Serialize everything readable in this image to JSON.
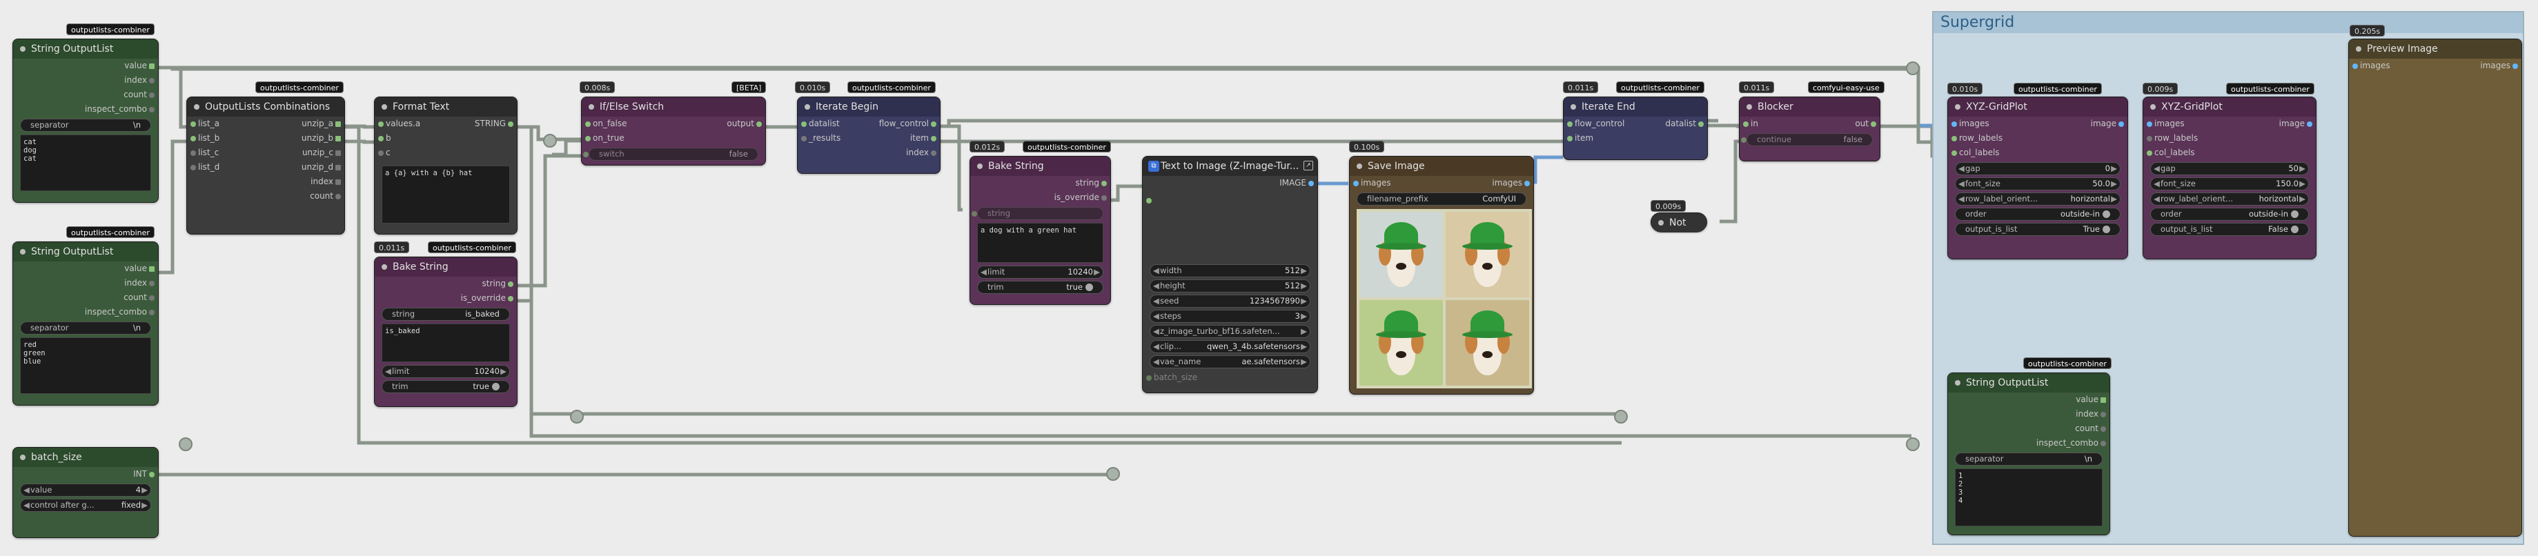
{
  "group": {
    "title": "Supergrid"
  },
  "badges": {
    "combiner": "outputlists-combiner",
    "easyuse": "comfyui-easy-use",
    "beta": "[BETA]"
  },
  "timers": {
    "ifelse": "0.008s",
    "iterbegin": "0.010s",
    "bake1": "0.012s",
    "bake2": "0.011s",
    "textimg": "",
    "save": "0.100s",
    "iterend": "0.011s",
    "blocker": "0.011s",
    "not": "0.009s",
    "xyz1": "0.010s",
    "xyz2": "0.009s",
    "preview": "0.205s"
  },
  "nodes": {
    "sol1": {
      "title": "String OutputList",
      "outputs": [
        "value",
        "index",
        "count",
        "inspect_combo"
      ],
      "sep_label": "separator",
      "sep_value": "\\n",
      "text": "cat\ndog\ncat"
    },
    "sol2": {
      "title": "String OutputList",
      "outputs": [
        "value",
        "index",
        "count",
        "inspect_combo"
      ],
      "sep_label": "separator",
      "sep_value": "\\n",
      "text": "red\ngreen\nblue"
    },
    "sol3": {
      "title": "String OutputList",
      "outputs": [
        "value",
        "index",
        "count",
        "inspect_combo"
      ],
      "sep_label": "separator",
      "sep_value": "\\n",
      "text": "1\n2\n3\n4"
    },
    "batch": {
      "title": "batch_size",
      "output": "INT",
      "value_label": "value",
      "value": "4",
      "ctrl_label": "control after g...",
      "ctrl_value": "fixed"
    },
    "olc": {
      "title": "OutputLists Combinations",
      "inputs": [
        "list_a",
        "list_b",
        "list_c",
        "list_d"
      ],
      "outputs": [
        "unzip_a",
        "unzip_b",
        "unzip_c",
        "unzip_d",
        "index",
        "count"
      ]
    },
    "fmt": {
      "title": "Format Text",
      "inputs": [
        "values.a",
        "b",
        "c"
      ],
      "output": "STRING",
      "text": "a {a} with a {b} hat"
    },
    "ifelse": {
      "title": "If/Else Switch",
      "inputs": [
        "on_false",
        "on_true"
      ],
      "output": "output",
      "sw_label": "switch",
      "sw_value": "false"
    },
    "iterbegin": {
      "title": "Iterate Begin",
      "inputs": [
        "datalist",
        "_results"
      ],
      "outputs": [
        "flow_control",
        "item",
        "index"
      ]
    },
    "bake1": {
      "title": "Bake String",
      "outputs": [
        "string",
        "is_override"
      ],
      "w_label": "string",
      "text": "a dog with a green hat",
      "limit_label": "limit",
      "limit": "10240",
      "trim_label": "trim",
      "trim": "true"
    },
    "bake2": {
      "title": "Bake String",
      "outputs": [
        "string",
        "is_override"
      ],
      "w_label": "string",
      "w_value": "is_baked",
      "text": "is_baked",
      "limit_label": "limit",
      "limit": "10240",
      "trim_label": "trim",
      "trim": "true"
    },
    "textimg": {
      "title": "Text to Image (Z-Image-Tur...",
      "output": "IMAGE",
      "widgets": [
        [
          "width",
          "512"
        ],
        [
          "height",
          "512"
        ],
        [
          "seed",
          "1234567890"
        ],
        [
          "steps",
          "3"
        ],
        [
          "z_image_turbo_bf16.safeten...",
          ""
        ],
        [
          "clip...",
          "qwen_3_4b.safetensors"
        ],
        [
          "vae_name",
          "ae.safetensors"
        ]
      ],
      "batch_label": "batch_size"
    },
    "save": {
      "title": "Save Image",
      "input": "images",
      "output": "images",
      "prefix_label": "filename_prefix",
      "prefix": "ComfyUI"
    },
    "iterend": {
      "title": "Iterate End",
      "inputs": [
        "flow_control",
        "item"
      ],
      "output": "datalist"
    },
    "blocker": {
      "title": "Blocker",
      "input": "in",
      "output": "out",
      "cont_label": "continue",
      "cont_value": "false"
    },
    "not": {
      "title": "Not"
    },
    "xyz1": {
      "title": "XYZ-GridPlot",
      "inputs": [
        "images",
        "row_labels",
        "col_labels"
      ],
      "output": "image",
      "widgets": [
        [
          "gap",
          "0"
        ],
        [
          "font_size",
          "50.0"
        ],
        [
          "row_label_orient...",
          "horizontal"
        ],
        [
          "order",
          "outside-in"
        ],
        [
          "output_is_list",
          "True"
        ]
      ]
    },
    "xyz2": {
      "title": "XYZ-GridPlot",
      "inputs": [
        "images",
        "row_labels",
        "col_labels"
      ],
      "output": "image",
      "widgets": [
        [
          "gap",
          "50"
        ],
        [
          "font_size",
          "150.0"
        ],
        [
          "row_label_orient...",
          "horizontal"
        ],
        [
          "order",
          "outside-in"
        ],
        [
          "output_is_list",
          "False"
        ]
      ]
    },
    "preview": {
      "title": "Preview Image",
      "input": "images",
      "output": "images"
    }
  }
}
